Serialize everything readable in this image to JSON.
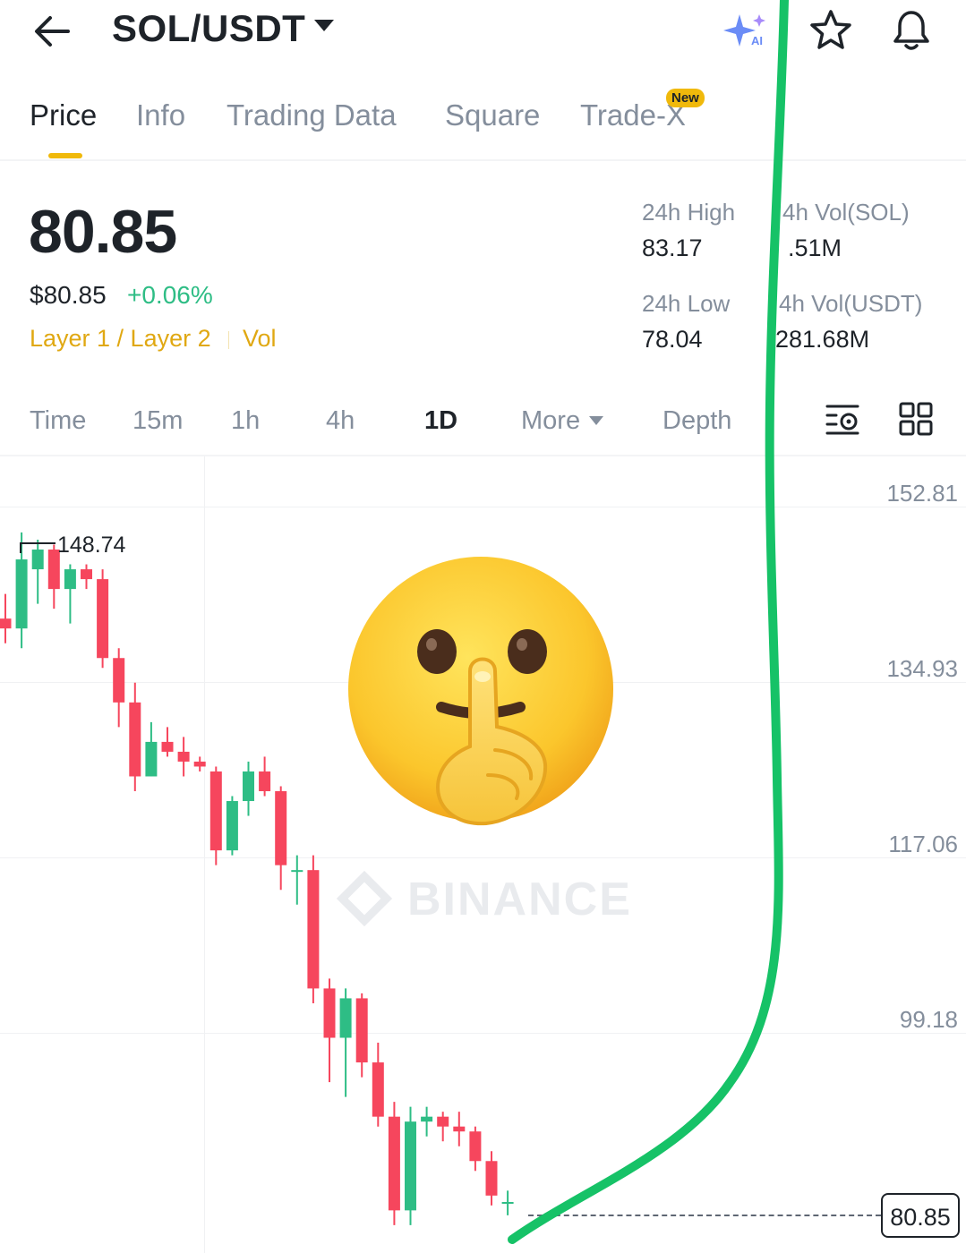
{
  "header": {
    "back_icon": "arrow-left-icon",
    "pair": "SOL/USDT",
    "ai_icon": "ai-sparkle-icon",
    "star_icon": "star-icon",
    "bell_icon": "bell-icon"
  },
  "tabs": [
    {
      "label": "Price",
      "active": true
    },
    {
      "label": "Info"
    },
    {
      "label": "Trading Data"
    },
    {
      "label": "Square"
    },
    {
      "label": "Trade-X",
      "badge": "New"
    }
  ],
  "price": {
    "last": "80.85",
    "usd": "$80.85",
    "change": "+0.06%",
    "tags": [
      "Layer 1 / Layer 2",
      "Vol"
    ]
  },
  "stats": {
    "high_label": "24h High",
    "high": "83.17",
    "vol_sol_label": "4h Vol(SOL)",
    "vol_sol": ".51M",
    "low_label": "24h Low",
    "low": "78.04",
    "vol_usdt_label": "4h Vol(USDT)",
    "vol_usdt": "281.68M"
  },
  "timeframes": [
    {
      "label": "Time"
    },
    {
      "label": "15m"
    },
    {
      "label": "1h"
    },
    {
      "label": "4h"
    },
    {
      "label": "1D",
      "active": true
    },
    {
      "label": "More"
    },
    {
      "label": "Depth"
    }
  ],
  "tools": {
    "settings_icon": "chart-settings-icon",
    "layout_icon": "grid-layout-icon"
  },
  "chart_data": {
    "type": "candlestick",
    "y_ticks": [
      "152.81",
      "134.93",
      "117.06",
      "99.18"
    ],
    "ylim": [
      78.0,
      155.0
    ],
    "high_marker": "148.74",
    "last_price": "80.85",
    "watermark": "BINANCE",
    "colors": {
      "up": "#2ebd85",
      "down": "#f6465d",
      "annotation": "#16c267"
    },
    "candles": [
      {
        "o": 140.0,
        "h": 142.5,
        "l": 137.5,
        "c": 139.0
      },
      {
        "o": 139.0,
        "h": 148.74,
        "l": 137.0,
        "c": 146.0
      },
      {
        "o": 145.0,
        "h": 148.0,
        "l": 141.5,
        "c": 147.0
      },
      {
        "o": 147.0,
        "h": 147.5,
        "l": 141.0,
        "c": 143.0
      },
      {
        "o": 143.0,
        "h": 145.5,
        "l": 139.5,
        "c": 145.0
      },
      {
        "o": 145.0,
        "h": 145.5,
        "l": 143.0,
        "c": 144.0
      },
      {
        "o": 144.0,
        "h": 145.0,
        "l": 135.0,
        "c": 136.0
      },
      {
        "o": 136.0,
        "h": 137.0,
        "l": 129.0,
        "c": 131.5
      },
      {
        "o": 131.5,
        "h": 133.5,
        "l": 122.5,
        "c": 124.0
      },
      {
        "o": 124.0,
        "h": 129.5,
        "l": 124.0,
        "c": 127.5
      },
      {
        "o": 127.5,
        "h": 129.0,
        "l": 126.0,
        "c": 126.5
      },
      {
        "o": 126.5,
        "h": 128.0,
        "l": 124.0,
        "c": 125.5
      },
      {
        "o": 125.5,
        "h": 126.0,
        "l": 124.5,
        "c": 125.0
      },
      {
        "o": 124.5,
        "h": 125.0,
        "l": 115.0,
        "c": 116.5
      },
      {
        "o": 116.5,
        "h": 122.0,
        "l": 116.0,
        "c": 121.5
      },
      {
        "o": 121.5,
        "h": 125.5,
        "l": 120.0,
        "c": 124.5
      },
      {
        "o": 124.5,
        "h": 126.0,
        "l": 122.0,
        "c": 122.5
      },
      {
        "o": 122.5,
        "h": 123.0,
        "l": 112.5,
        "c": 115.0
      },
      {
        "o": 114.5,
        "h": 116.0,
        "l": 111.0,
        "c": 114.5
      },
      {
        "o": 114.5,
        "h": 116.0,
        "l": 101.0,
        "c": 102.5
      },
      {
        "o": 102.5,
        "h": 103.5,
        "l": 93.0,
        "c": 97.5
      },
      {
        "o": 97.5,
        "h": 102.5,
        "l": 91.5,
        "c": 101.5
      },
      {
        "o": 101.5,
        "h": 102.0,
        "l": 93.5,
        "c": 95.0
      },
      {
        "o": 95.0,
        "h": 97.0,
        "l": 88.5,
        "c": 89.5
      },
      {
        "o": 89.5,
        "h": 91.0,
        "l": 78.5,
        "c": 80.0
      },
      {
        "o": 80.0,
        "h": 90.5,
        "l": 78.5,
        "c": 89.0
      },
      {
        "o": 89.0,
        "h": 90.5,
        "l": 87.5,
        "c": 89.5
      },
      {
        "o": 89.5,
        "h": 90.0,
        "l": 87.0,
        "c": 88.5
      },
      {
        "o": 88.5,
        "h": 90.0,
        "l": 86.5,
        "c": 88.0
      },
      {
        "o": 88.0,
        "h": 88.5,
        "l": 84.0,
        "c": 85.0
      },
      {
        "o": 85.0,
        "h": 86.0,
        "l": 80.5,
        "c": 81.5
      },
      {
        "o": 80.8,
        "h": 82.0,
        "l": 79.5,
        "c": 80.85
      }
    ]
  }
}
